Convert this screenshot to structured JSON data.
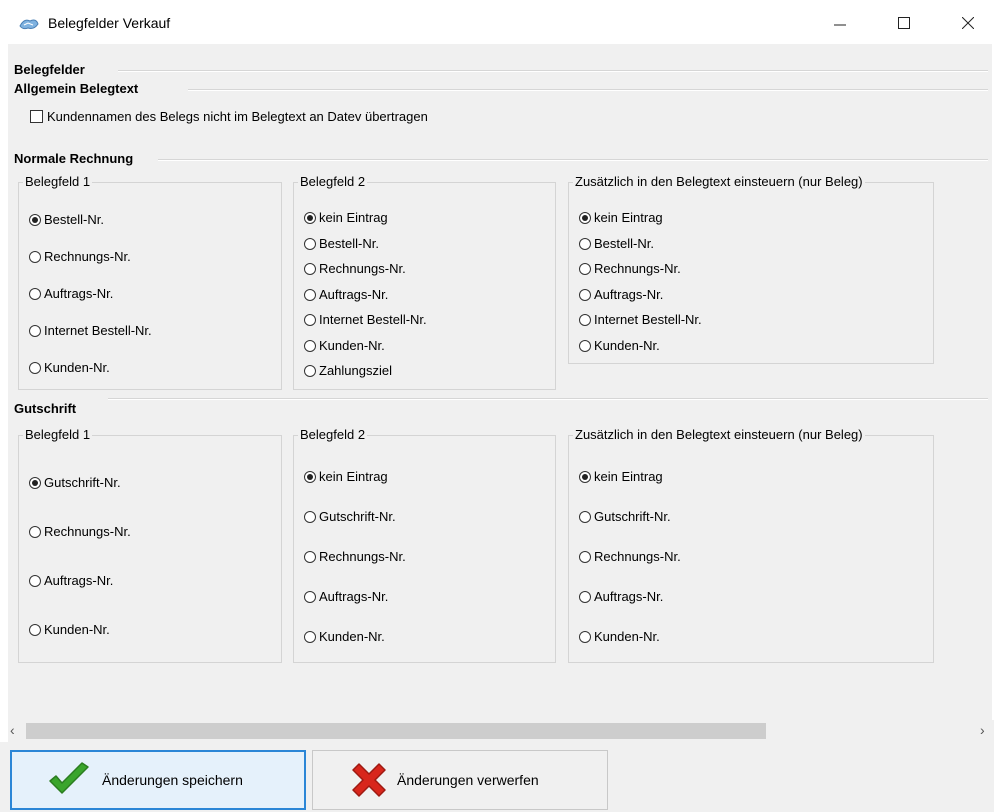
{
  "window": {
    "title": "Belegfelder Verkauf",
    "icon": "app-icon",
    "controls": {
      "minimize": "minimize-icon",
      "maximize": "maximize-icon",
      "close": "close-icon"
    }
  },
  "main": {
    "section_title": "Belegfelder",
    "allgemein": {
      "title": "Allgemein Belegtext",
      "checkbox_label": "Kundennamen des Belegs nicht im Belegtext an Datev übertragen",
      "checked": false
    },
    "normale_rechnung": {
      "title": "Normale Rechnung",
      "groups": [
        {
          "title": "Belegfeld 1",
          "options": [
            "Bestell-Nr.",
            "Rechnungs-Nr.",
            "Auftrags-Nr.",
            "Internet Bestell-Nr.",
            "Kunden-Nr."
          ],
          "selected": "Bestell-Nr."
        },
        {
          "title": "Belegfeld 2",
          "options": [
            "kein Eintrag",
            "Bestell-Nr.",
            "Rechnungs-Nr.",
            "Auftrags-Nr.",
            "Internet Bestell-Nr.",
            "Kunden-Nr.",
            "Zahlungsziel"
          ],
          "selected": "kein Eintrag"
        },
        {
          "title": "Zusätzlich in den Belegtext einsteuern (nur Beleg)",
          "options": [
            "kein Eintrag",
            "Bestell-Nr.",
            "Rechnungs-Nr.",
            "Auftrags-Nr.",
            "Internet Bestell-Nr.",
            "Kunden-Nr."
          ],
          "selected": "kein Eintrag"
        }
      ]
    },
    "gutschrift": {
      "title": "Gutschrift",
      "groups": [
        {
          "title": "Belegfeld 1",
          "options": [
            "Gutschrift-Nr.",
            "Rechnungs-Nr.",
            "Auftrags-Nr.",
            "Kunden-Nr."
          ],
          "selected": "Gutschrift-Nr."
        },
        {
          "title": "Belegfeld 2",
          "options": [
            "kein Eintrag",
            "Gutschrift-Nr.",
            "Rechnungs-Nr.",
            "Auftrags-Nr.",
            "Kunden-Nr."
          ],
          "selected": "kein Eintrag"
        },
        {
          "title": "Zusätzlich in den Belegtext einsteuern (nur Beleg)",
          "options": [
            "kein Eintrag",
            "Gutschrift-Nr.",
            "Rechnungs-Nr.",
            "Auftrags-Nr.",
            "Kunden-Nr."
          ],
          "selected": "kein Eintrag"
        }
      ]
    }
  },
  "buttons": {
    "save": {
      "label": "Änderungen speichern",
      "icon": "green-checkmark-icon",
      "color": "#3aa52c"
    },
    "discard": {
      "label": "Änderungen verwerfen",
      "icon": "red-x-icon",
      "color": "#d8261c"
    }
  },
  "colors": {
    "accent_border": "#2b86d6",
    "dialog_bg": "#f0f0f0"
  }
}
